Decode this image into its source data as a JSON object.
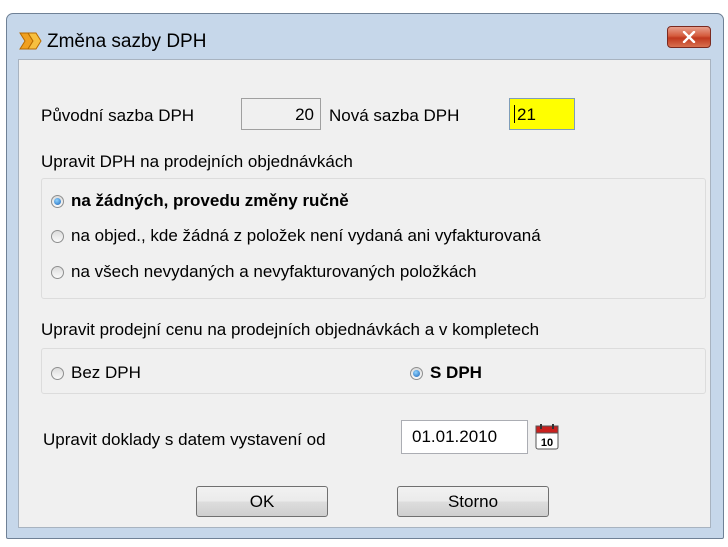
{
  "window": {
    "title": "Změna sazby DPH"
  },
  "rates": {
    "original_label": "Původní sazba DPH",
    "original_value": "20",
    "new_label": "Nová sazba DPH",
    "new_value": "21",
    "new_value_bg": "#ffff00"
  },
  "orders_section": {
    "heading": "Upravit DPH na prodejních objednávkách",
    "options": [
      {
        "label": "na žádných, provedu změny ručně",
        "selected": true
      },
      {
        "label": "na objed., kde žádná z položek není vydaná ani vyfakturovaná",
        "selected": false
      },
      {
        "label": "na všech nevydaných a nevyfakturovaných položkách",
        "selected": false
      }
    ]
  },
  "price_section": {
    "heading": "Upravit prodejní cenu na prodejních objednávkách a v kompletech",
    "options": [
      {
        "label": "Bez DPH",
        "selected": false
      },
      {
        "label": "S DPH",
        "selected": true
      }
    ]
  },
  "date_section": {
    "label": "Upravit doklady s datem vystavení od",
    "value": "01.01.2010",
    "calendar_day": "10"
  },
  "buttons": {
    "ok": "OK",
    "cancel": "Storno"
  }
}
